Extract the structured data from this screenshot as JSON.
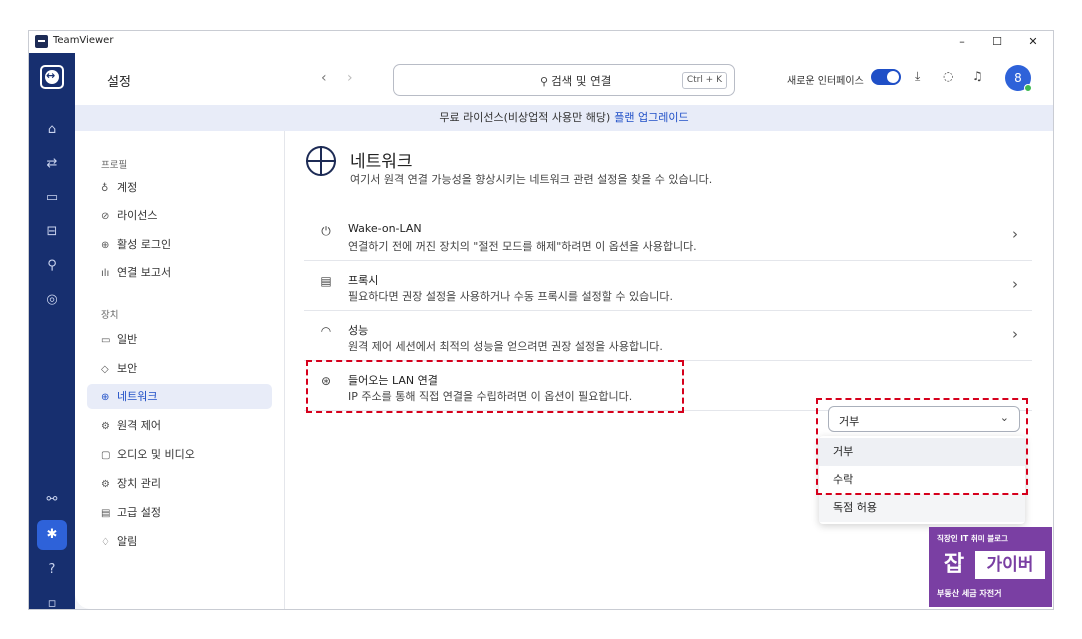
{
  "window": {
    "title": "TeamViewer",
    "minimize": "–",
    "maximize": "☐",
    "close": "✕"
  },
  "header": {
    "page_title": "설정",
    "back": "‹",
    "forward": "›",
    "search_icon": "magnifier-icon",
    "search_label": "검색 및 연결",
    "search_shortcut": "Ctrl + K",
    "new_ui_label": "새로운 인터페이스",
    "new_ui_toggle_on": true,
    "avatar_initial": "8"
  },
  "banner": {
    "text": "무료 라이선스(비상업적 사용만 해당)",
    "link": "플랜 업그레이드"
  },
  "nav": {
    "section_profile": "프로필",
    "account": "계정",
    "license": "라이선스",
    "active_logins": "활성 로그인",
    "connection_report": "연결 보고서",
    "section_device": "장치",
    "general": "일반",
    "security": "보안",
    "network": "네트워크",
    "remote_control": "원격 제어",
    "audio_video": "오디오 및 비디오",
    "device_management": "장치 관리",
    "advanced": "고급 설정",
    "notifications": "알림"
  },
  "panel": {
    "title": "네트워크",
    "subtitle": "여기서 원격 연결 가능성을 향상시키는 네트워크 관련 설정을 찾을 수 있습니다.",
    "rows": [
      {
        "title": "Wake-on-LAN",
        "desc": "연결하기 전에 꺼진 장치의 \"절전 모드를 해제\"하려면 이 옵션을 사용합니다."
      },
      {
        "title": "프록시",
        "desc": "필요하다면 권장 설정을 사용하거나 수동 프록시를 설정할 수 있습니다."
      },
      {
        "title": "성능",
        "desc": "원격 제어 세션에서 최적의 성능을 얻으려면 권장 설정을 사용합니다."
      },
      {
        "title": "들어오는 LAN 연결",
        "desc": "IP 주소를 통해 직접 연결을 수립하려면 이 옵션이 필요합니다."
      }
    ],
    "lan_select_value": "거부",
    "lan_options": [
      "거부",
      "수락",
      "독점 허용"
    ]
  },
  "watermark": {
    "top": "직장인 IT 취미 블로그",
    "big1": "잡",
    "big2": "가이버",
    "bottom": "부동산 세금 자전거"
  },
  "colors": {
    "rail": "#172f6f",
    "accent": "#1f4fc7",
    "highlight_box": "#d6001c"
  }
}
